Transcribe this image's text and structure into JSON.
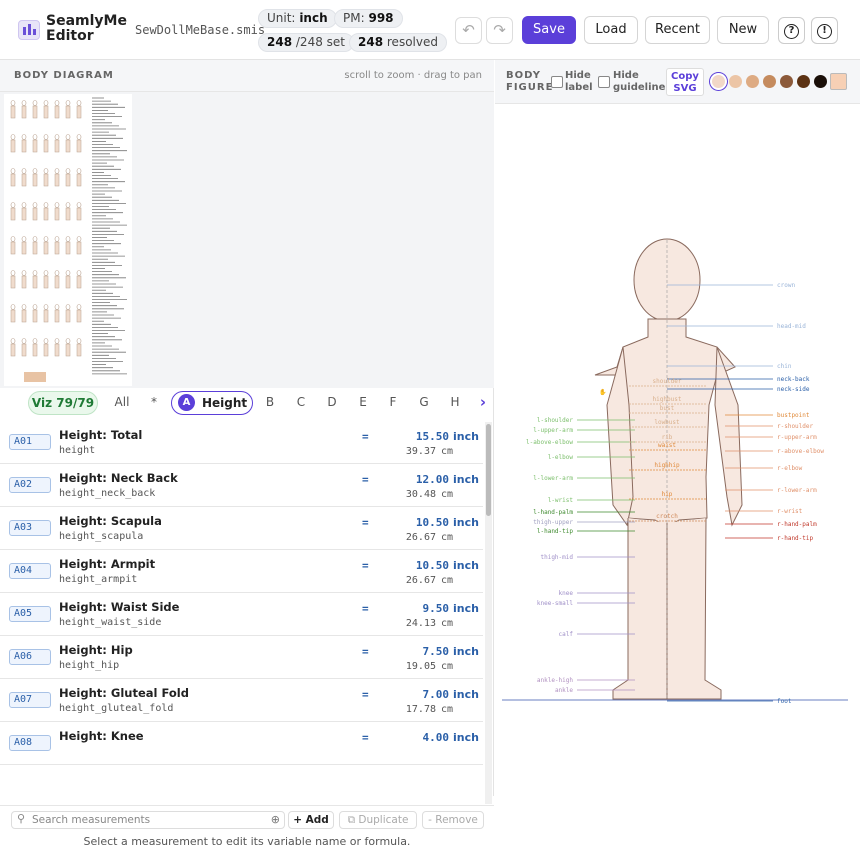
{
  "app": {
    "title_line1": "SeamlyMe",
    "title_line2": "Editor",
    "file_name": "SewDollMeBase.smis"
  },
  "status": {
    "unit_label": "Unit:",
    "unit_value": "inch",
    "pm_label": "PM:",
    "pm_value": "998",
    "set_count": "248",
    "set_total": "/248 set",
    "resolved_count": "248",
    "resolved_label": "resolved"
  },
  "toolbar": {
    "undo_icon": "undo-icon",
    "redo_icon": "redo-icon",
    "save": "Save",
    "load": "Load",
    "recent": "Recent",
    "new": "New",
    "help_glyph": "?",
    "info_glyph": "!"
  },
  "diagram": {
    "title": "BODY DIAGRAM",
    "hint": "scroll to zoom · drag to pan"
  },
  "tabs": {
    "viz": "Viz 79/79",
    "all": "All",
    "star": "*",
    "active_letter": "A",
    "active_label": "Height",
    "letters": [
      "B",
      "C",
      "D",
      "E",
      "F",
      "G",
      "H"
    ],
    "next_icon": "chevron-right-icon"
  },
  "measurements": [
    {
      "code": "A01",
      "name": "Height: Total",
      "var": "height",
      "value": "15.50",
      "unit": "inch",
      "cm": "39.37",
      "cm_unit": "cm"
    },
    {
      "code": "A02",
      "name": "Height: Neck Back",
      "var": "height_neck_back",
      "value": "12.00",
      "unit": "inch",
      "cm": "30.48",
      "cm_unit": "cm"
    },
    {
      "code": "A03",
      "name": "Height: Scapula",
      "var": "height_scapula",
      "value": "10.50",
      "unit": "inch",
      "cm": "26.67",
      "cm_unit": "cm"
    },
    {
      "code": "A04",
      "name": "Height: Armpit",
      "var": "height_armpit",
      "value": "10.50",
      "unit": "inch",
      "cm": "26.67",
      "cm_unit": "cm"
    },
    {
      "code": "A05",
      "name": "Height: Waist Side",
      "var": "height_waist_side",
      "value": "9.50",
      "unit": "inch",
      "cm": "24.13",
      "cm_unit": "cm"
    },
    {
      "code": "A06",
      "name": "Height: Hip",
      "var": "height_hip",
      "value": "7.50",
      "unit": "inch",
      "cm": "19.05",
      "cm_unit": "cm"
    },
    {
      "code": "A07",
      "name": "Height: Gluteal Fold",
      "var": "height_gluteal_fold",
      "value": "7.00",
      "unit": "inch",
      "cm": "17.78",
      "cm_unit": "cm"
    },
    {
      "code": "A08",
      "name": "Height: Knee",
      "var": "",
      "value": "4.00",
      "unit": "inch",
      "cm": "",
      "cm_unit": ""
    }
  ],
  "equals": "=",
  "bottom": {
    "search_placeholder": "Search measurements",
    "add": "+ Add",
    "duplicate": "Duplicate",
    "remove": "- Remove",
    "hint": "Select a measurement to edit its variable name or formula."
  },
  "figure": {
    "title_line1": "BODY",
    "title_line2": "FIGURE",
    "hide_label": [
      "Hide",
      "label"
    ],
    "hide_guideline": [
      "Hide",
      "guideline"
    ],
    "copy_svg": [
      "Copy",
      "SVG"
    ],
    "swatches": [
      "#f2d8c8",
      "#ecc5a6",
      "#deab83",
      "#c58b5e",
      "#8c5a3a",
      "#5c3213",
      "#1a0f08"
    ],
    "custom_swatch": "#f7d0b5",
    "labels_right": [
      "crown",
      "head-mid",
      "chin",
      "neck-back",
      "neck-side",
      "bustpoint",
      "r-shoulder",
      "r-upper-arm",
      "r-above-elbow",
      "r-elbow",
      "r-lower-arm",
      "r-wrist",
      "r-hand-palm",
      "r-hand-tip",
      "foot"
    ],
    "labels_left": [
      "l-shoulder",
      "l-upper-arm",
      "l-above-elbow",
      "l-elbow",
      "l-lower-arm",
      "l-wrist",
      "l-hand-palm",
      "thigh-upper",
      "l-hand-tip",
      "thigh-mid",
      "knee",
      "knee-small",
      "calf",
      "ankle-high",
      "ankle"
    ],
    "labels_center": [
      "shoulder",
      "highbust",
      "bust",
      "lowbust",
      "rib",
      "waist",
      "highhip",
      "hip",
      "crotch"
    ]
  }
}
